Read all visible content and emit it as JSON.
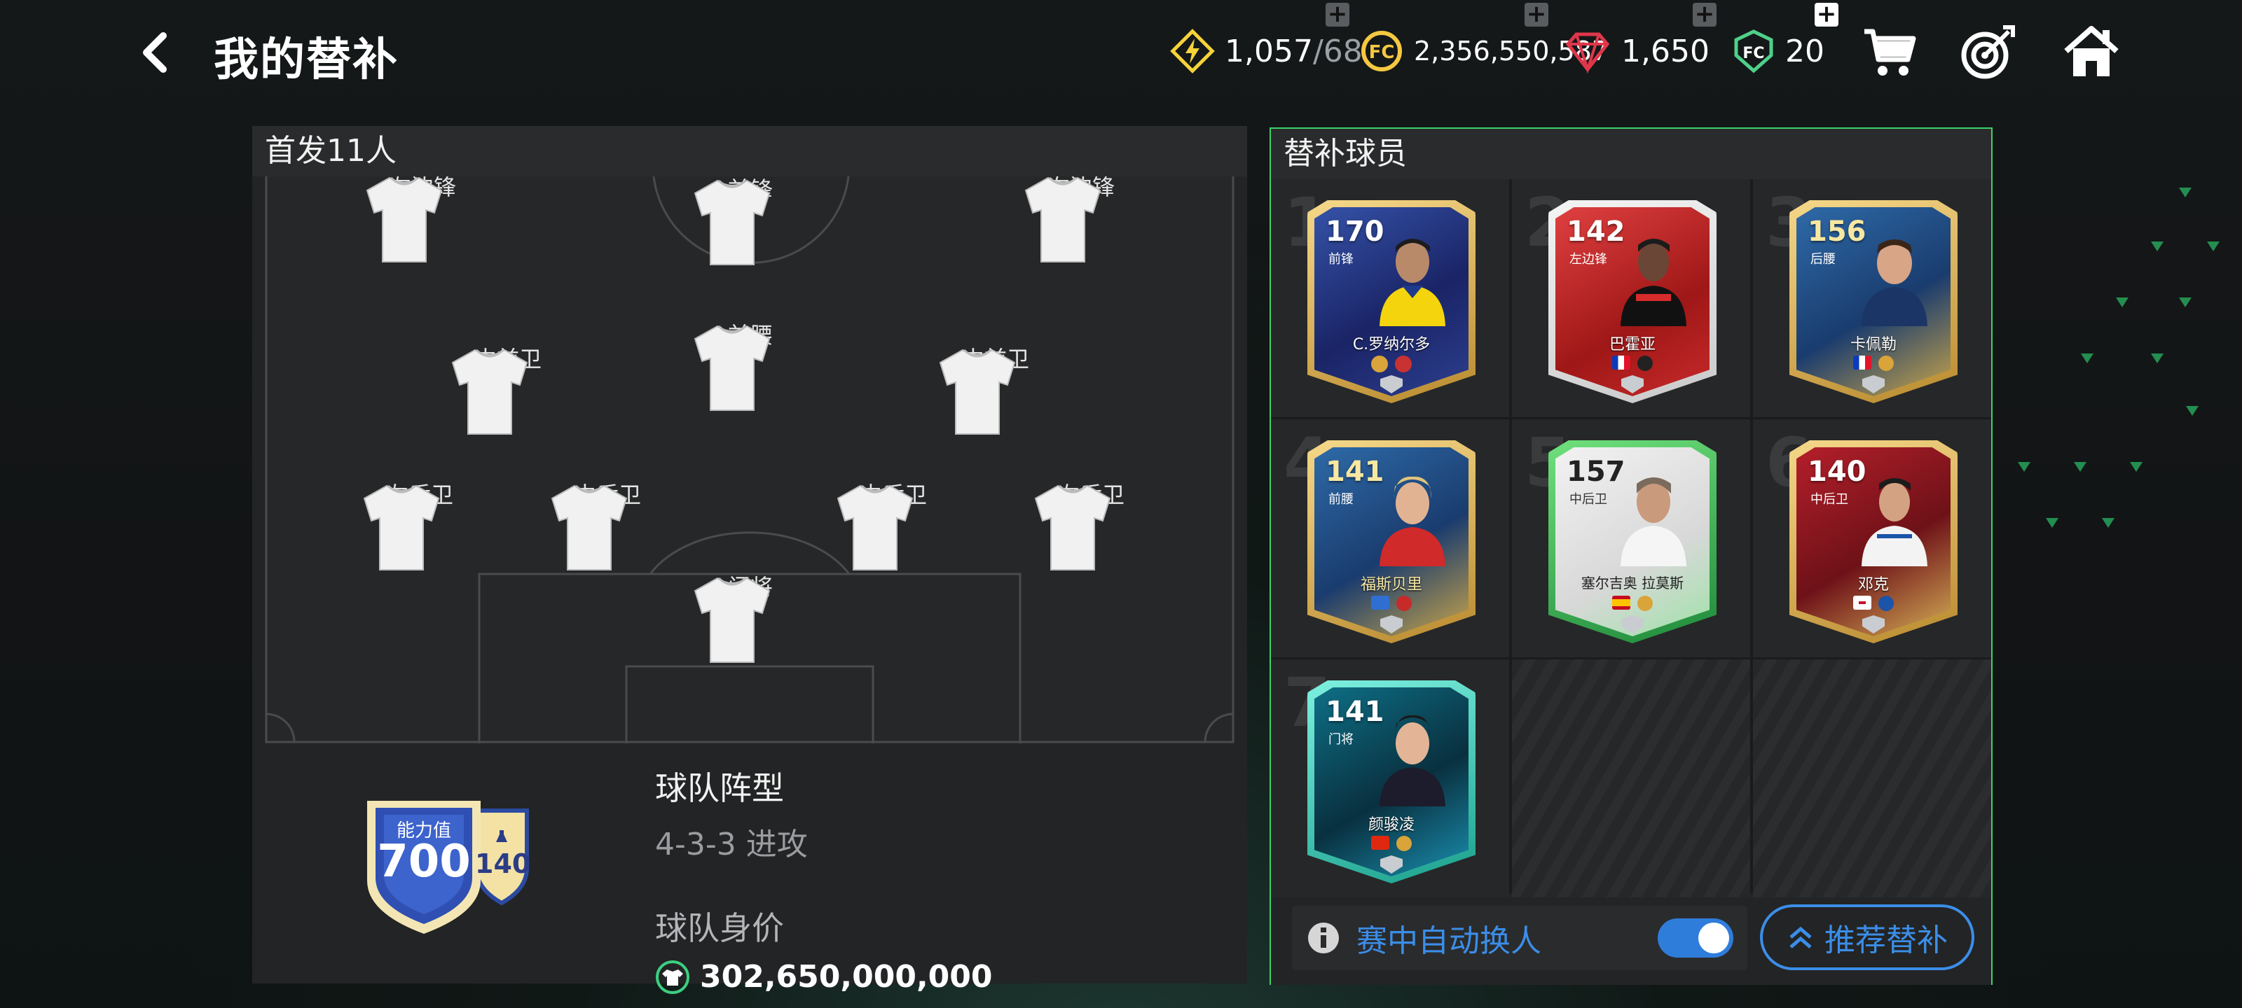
{
  "header": {
    "title": "我的替补",
    "currencies": [
      {
        "name": "energy",
        "value": "1,057",
        "max": "/68",
        "color": "#f5d33a"
      },
      {
        "name": "coins",
        "value": "2,356,550,587",
        "color": "#f5c842"
      },
      {
        "name": "gems",
        "value": "1,650",
        "color": "#e0364a"
      },
      {
        "name": "fc-points",
        "value": "20",
        "color": "#4fd08a"
      }
    ]
  },
  "lineup": {
    "heading": "首发11人",
    "positions": {
      "lw": "左边锋",
      "st": "前锋",
      "rw": "右边锋",
      "lcm": "中前卫",
      "cam": "前腰",
      "rcm": "中前卫",
      "lb": "左后卫",
      "lcb": "中后卫",
      "rcb": "中后卫",
      "rb": "右后卫",
      "gk": "门将"
    },
    "badge": {
      "label": "能力值",
      "ovr": "700",
      "sub": "140"
    },
    "formation_label": "球队阵型",
    "formation": "4-3-3 进攻",
    "value_label": "球队身价",
    "value": "302,650,000,000"
  },
  "subs": {
    "heading": "替补球员",
    "slots": [
      {
        "idx": "1",
        "ovr": "170",
        "pos": "前锋",
        "name": "C.罗纳尔多",
        "theme": "blue-gold"
      },
      {
        "idx": "2",
        "ovr": "142",
        "pos": "左边锋",
        "name": "巴霍亚",
        "theme": "red"
      },
      {
        "idx": "3",
        "ovr": "156",
        "pos": "后腰",
        "name": "卡佩勒",
        "theme": "blue-gold"
      },
      {
        "idx": "4",
        "ovr": "141",
        "pos": "前腰",
        "name": "福斯贝里",
        "theme": "blue-gold"
      },
      {
        "idx": "5",
        "ovr": "157",
        "pos": "中后卫",
        "name": "塞尔吉奥 拉莫斯",
        "theme": "green-white"
      },
      {
        "idx": "6",
        "ovr": "140",
        "pos": "中后卫",
        "name": "邓克",
        "theme": "red-gold"
      },
      {
        "idx": "7",
        "ovr": "141",
        "pos": "门将",
        "name": "颜骏凌",
        "theme": "teal"
      }
    ],
    "auto_sub_label": "赛中自动换人",
    "auto_sub_on": true,
    "recommend_label": "推荐替补"
  }
}
